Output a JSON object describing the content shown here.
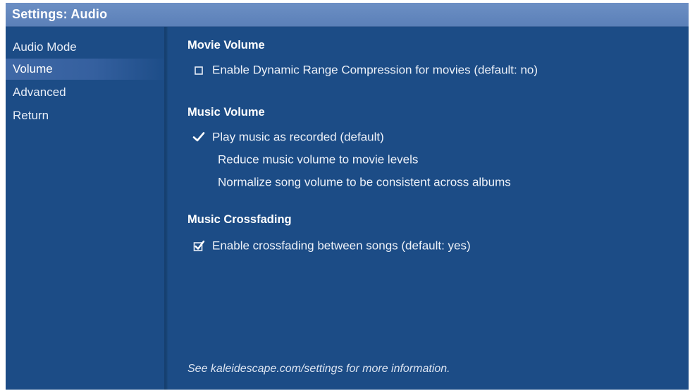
{
  "window": {
    "title": "Settings: Audio"
  },
  "sidebar": {
    "items": [
      {
        "label": "Audio Mode",
        "selected": false
      },
      {
        "label": "Volume",
        "selected": true
      },
      {
        "label": "Advanced",
        "selected": false
      },
      {
        "label": "Return",
        "selected": false
      }
    ]
  },
  "main": {
    "sections": [
      {
        "heading": "Movie Volume",
        "options": [
          {
            "label": "Enable Dynamic Range Compression for movies (default: no)",
            "control": "checkbox",
            "checked": false
          }
        ]
      },
      {
        "heading": "Music Volume",
        "options": [
          {
            "label": "Play music as recorded (default)",
            "control": "radio",
            "selected": true
          },
          {
            "label": "Reduce music volume to movie levels",
            "control": "radio",
            "selected": false
          },
          {
            "label": "Normalize song volume to be consistent across albums",
            "control": "radio",
            "selected": false
          }
        ]
      },
      {
        "heading": "Music Crossfading",
        "options": [
          {
            "label": "Enable crossfading between songs (default: yes)",
            "control": "checkbox",
            "checked": true
          }
        ]
      }
    ],
    "footer": "See kaleidescape.com/settings for more information."
  },
  "colors": {
    "background": "#1c4c86",
    "titlebar": "#6384bd",
    "selection": "#3f68a6",
    "text": "#ffffff"
  },
  "icons": {
    "checkbox_unchecked": "empty-square-icon",
    "checkbox_checked": "checked-square-icon",
    "radio_selected": "checkmark-icon"
  }
}
